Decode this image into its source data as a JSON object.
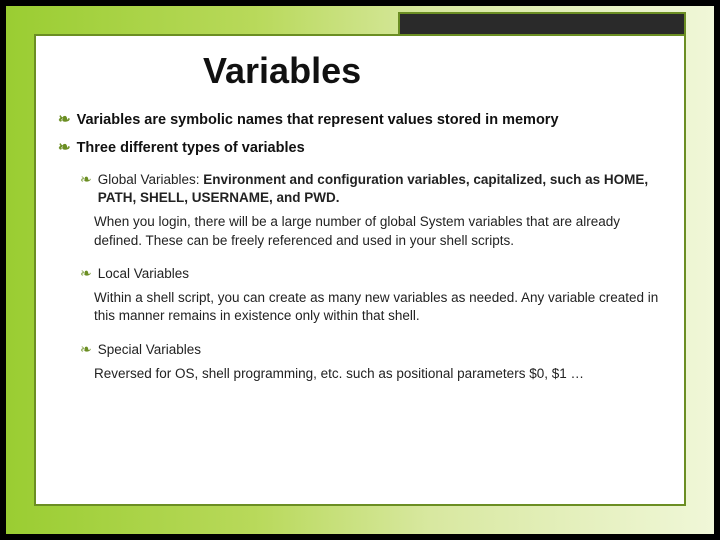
{
  "title": "Variables",
  "b1": {
    "strong": "Variables",
    "rest": " are symbolic names that represent values stored in memory"
  },
  "b2": {
    "strong": "Three",
    "rest": " different types of variables"
  },
  "sub1": {
    "lead": "Global Variables:",
    "rest": " Environment and configuration variables, capitalized, such as HOME, PATH, SHELL, USERNAME, and PWD."
  },
  "p1": "When you login, there will be a large number of global System variables that are already defined. These can be freely referenced and used in your shell scripts.",
  "sub2": "Local Variables",
  "p2": "Within a shell script, you can create as many new variables as needed. Any variable created in this manner remains in existence only within that shell.",
  "sub3": "Special Variables",
  "p3": "Reversed for OS, shell programming, etc. such as positional parameters $0, $1 …",
  "glyph": "❧"
}
